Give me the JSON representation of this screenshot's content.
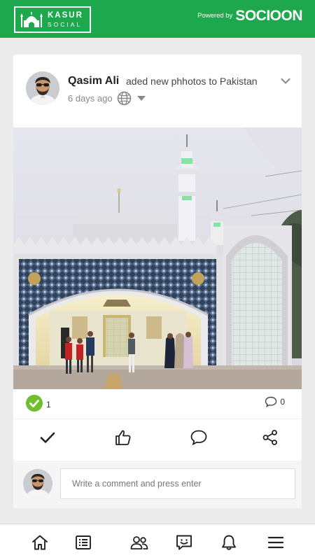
{
  "colors": {
    "brand": "#1ea84d",
    "checkmark": "#6fbe2d"
  },
  "header": {
    "logo_title": "KASUR",
    "logo_subtitle": "SOCIAL",
    "powered_label": "Powered by",
    "powered_brand": "SOCIOON"
  },
  "post": {
    "author": "Qasim Ali",
    "action_text": "aded new phhotos to Pakistan",
    "time": "6 days ago",
    "privacy_icon": "globe-icon",
    "photo_subject": "mosque shrine with marble arch and minarets",
    "reaction_count": "1",
    "comment_count": "0",
    "actions": [
      "check-icon",
      "thumbs-up-icon",
      "comment-icon",
      "share-icon"
    ]
  },
  "composer": {
    "placeholder": "Write a comment and press enter"
  },
  "bottom_nav": [
    "home-icon",
    "feed-icon",
    "friends-icon",
    "messages-icon",
    "notifications-icon",
    "menu-icon"
  ]
}
